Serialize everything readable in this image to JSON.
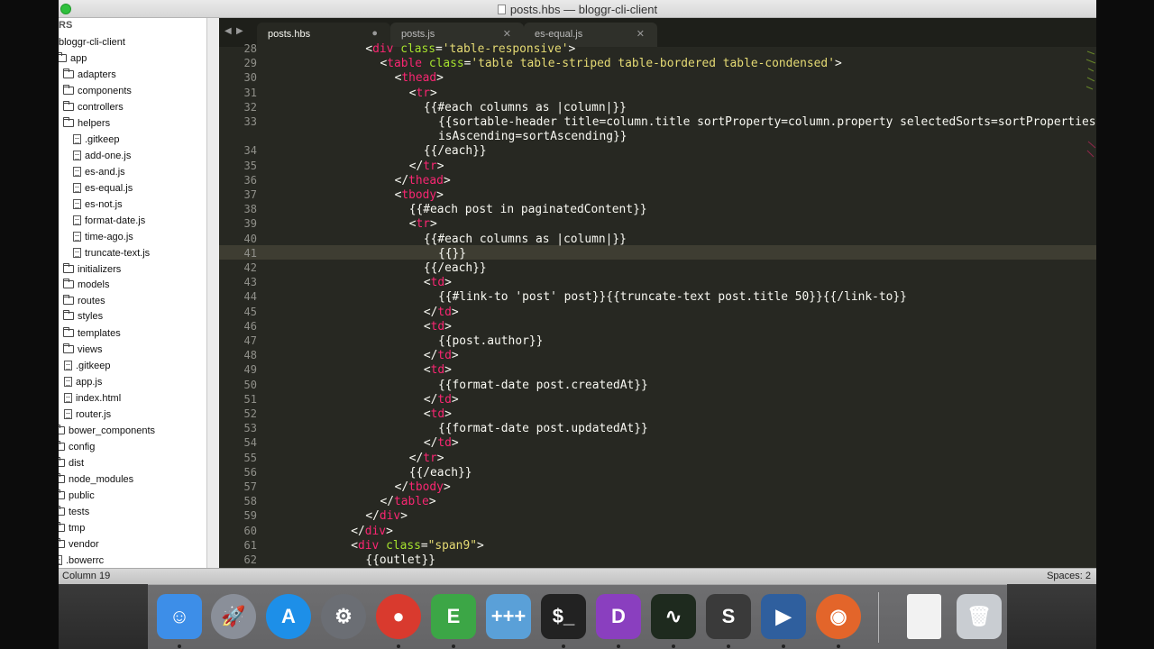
{
  "window": {
    "title": "posts.hbs — bloggr-cli-client"
  },
  "sidebar": {
    "header": "RS",
    "items": [
      {
        "label": "bloggr-cli-client",
        "kind": "root",
        "depth": 0
      },
      {
        "label": "app",
        "kind": "folder-open",
        "depth": 1
      },
      {
        "label": "adapters",
        "kind": "folder",
        "depth": 2
      },
      {
        "label": "components",
        "kind": "folder",
        "depth": 2
      },
      {
        "label": "controllers",
        "kind": "folder",
        "depth": 2
      },
      {
        "label": "helpers",
        "kind": "folder-open",
        "depth": 2
      },
      {
        "label": ".gitkeep",
        "kind": "file",
        "depth": 3
      },
      {
        "label": "add-one.js",
        "kind": "file",
        "depth": 3
      },
      {
        "label": "es-and.js",
        "kind": "file",
        "depth": 3
      },
      {
        "label": "es-equal.js",
        "kind": "file",
        "depth": 3
      },
      {
        "label": "es-not.js",
        "kind": "file",
        "depth": 3
      },
      {
        "label": "format-date.js",
        "kind": "file",
        "depth": 3
      },
      {
        "label": "time-ago.js",
        "kind": "file",
        "depth": 3
      },
      {
        "label": "truncate-text.js",
        "kind": "file",
        "depth": 3
      },
      {
        "label": "initializers",
        "kind": "folder",
        "depth": 2
      },
      {
        "label": "models",
        "kind": "folder",
        "depth": 2
      },
      {
        "label": "routes",
        "kind": "folder",
        "depth": 2
      },
      {
        "label": "styles",
        "kind": "folder",
        "depth": 2
      },
      {
        "label": "templates",
        "kind": "folder",
        "depth": 2
      },
      {
        "label": "views",
        "kind": "folder",
        "depth": 2
      },
      {
        "label": ".gitkeep",
        "kind": "file",
        "depth": 2
      },
      {
        "label": "app.js",
        "kind": "file",
        "depth": 2
      },
      {
        "label": "index.html",
        "kind": "file",
        "depth": 2
      },
      {
        "label": "router.js",
        "kind": "file",
        "depth": 2
      },
      {
        "label": "bower_components",
        "kind": "folder",
        "depth": 1
      },
      {
        "label": "config",
        "kind": "folder",
        "depth": 1
      },
      {
        "label": "dist",
        "kind": "folder",
        "depth": 1
      },
      {
        "label": "node_modules",
        "kind": "folder",
        "depth": 1
      },
      {
        "label": "public",
        "kind": "folder",
        "depth": 1
      },
      {
        "label": "tests",
        "kind": "folder",
        "depth": 1
      },
      {
        "label": "tmp",
        "kind": "folder",
        "depth": 1
      },
      {
        "label": "vendor",
        "kind": "folder",
        "depth": 1
      },
      {
        "label": ".bowerrc",
        "kind": "file",
        "depth": 1
      }
    ]
  },
  "tabs": [
    {
      "label": "posts.hbs",
      "active": true,
      "close": "●"
    },
    {
      "label": "posts.js",
      "active": false,
      "close": "✕"
    },
    {
      "label": "es-equal.js",
      "active": false,
      "close": "✕"
    }
  ],
  "tab_nav": {
    "prev": "◀",
    "next": "▶"
  },
  "editor": {
    "current_line": "41",
    "lines": [
      {
        "n": "28",
        "indent": 6,
        "segs": [
          [
            "<",
            "p"
          ],
          [
            "div",
            "tg"
          ],
          [
            " ",
            "p"
          ],
          [
            "class",
            "at"
          ],
          [
            "=",
            "p"
          ],
          [
            "'table-responsive'",
            "st"
          ],
          [
            ">",
            "p"
          ]
        ]
      },
      {
        "n": "29",
        "indent": 8,
        "segs": [
          [
            "<",
            "p"
          ],
          [
            "table",
            "tg"
          ],
          [
            " ",
            "p"
          ],
          [
            "class",
            "at"
          ],
          [
            "=",
            "p"
          ],
          [
            "'table table-striped table-bordered table-condensed'",
            "st"
          ],
          [
            ">",
            "p"
          ]
        ]
      },
      {
        "n": "30",
        "indent": 10,
        "segs": [
          [
            "<",
            "p"
          ],
          [
            "thead",
            "tg"
          ],
          [
            ">",
            "p"
          ]
        ]
      },
      {
        "n": "31",
        "indent": 12,
        "segs": [
          [
            "<",
            "p"
          ],
          [
            "tr",
            "tg"
          ],
          [
            ">",
            "p"
          ]
        ]
      },
      {
        "n": "32",
        "indent": 14,
        "segs": [
          [
            "{{#each columns as |column|}}",
            "p"
          ]
        ]
      },
      {
        "n": "33",
        "indent": 16,
        "segs": [
          [
            "{{sortable-header title=column.title sortProperty=column.property selectedSorts=sortProperties",
            "p"
          ]
        ]
      },
      {
        "n": "",
        "indent": 16,
        "segs": [
          [
            "isAscending=sortAscending}}",
            "p"
          ]
        ]
      },
      {
        "n": "34",
        "indent": 14,
        "segs": [
          [
            "{{/each}}",
            "p"
          ]
        ]
      },
      {
        "n": "35",
        "indent": 12,
        "segs": [
          [
            "</",
            "p"
          ],
          [
            "tr",
            "tg"
          ],
          [
            ">",
            "p"
          ]
        ]
      },
      {
        "n": "36",
        "indent": 10,
        "segs": [
          [
            "</",
            "p"
          ],
          [
            "thead",
            "tg"
          ],
          [
            ">",
            "p"
          ]
        ]
      },
      {
        "n": "37",
        "indent": 10,
        "segs": [
          [
            "<",
            "p"
          ],
          [
            "tbody",
            "tg"
          ],
          [
            ">",
            "p"
          ]
        ]
      },
      {
        "n": "38",
        "indent": 12,
        "segs": [
          [
            "{{#each post in paginatedContent}}",
            "p"
          ]
        ]
      },
      {
        "n": "39",
        "indent": 12,
        "segs": [
          [
            "<",
            "p"
          ],
          [
            "tr",
            "tg"
          ],
          [
            ">",
            "p"
          ]
        ]
      },
      {
        "n": "40",
        "indent": 14,
        "segs": [
          [
            "{{#each columns as |column|}}",
            "p"
          ]
        ]
      },
      {
        "n": "41",
        "indent": 16,
        "segs": [
          [
            "{{}}",
            "p"
          ]
        ]
      },
      {
        "n": "42",
        "indent": 14,
        "segs": [
          [
            "{{/each}}",
            "p"
          ]
        ]
      },
      {
        "n": "43",
        "indent": 14,
        "segs": [
          [
            "<",
            "p"
          ],
          [
            "td",
            "tg"
          ],
          [
            ">",
            "p"
          ]
        ]
      },
      {
        "n": "44",
        "indent": 16,
        "segs": [
          [
            "{{#link-to 'post' post}}{{truncate-text post.title 50}}{{/link-to}}",
            "p"
          ]
        ]
      },
      {
        "n": "45",
        "indent": 14,
        "segs": [
          [
            "</",
            "p"
          ],
          [
            "td",
            "tg"
          ],
          [
            ">",
            "p"
          ]
        ]
      },
      {
        "n": "46",
        "indent": 14,
        "segs": [
          [
            "<",
            "p"
          ],
          [
            "td",
            "tg"
          ],
          [
            ">",
            "p"
          ]
        ]
      },
      {
        "n": "47",
        "indent": 16,
        "segs": [
          [
            "{{post.author}}",
            "p"
          ]
        ]
      },
      {
        "n": "48",
        "indent": 14,
        "segs": [
          [
            "</",
            "p"
          ],
          [
            "td",
            "tg"
          ],
          [
            ">",
            "p"
          ]
        ]
      },
      {
        "n": "49",
        "indent": 14,
        "segs": [
          [
            "<",
            "p"
          ],
          [
            "td",
            "tg"
          ],
          [
            ">",
            "p"
          ]
        ]
      },
      {
        "n": "50",
        "indent": 16,
        "segs": [
          [
            "{{format-date post.createdAt}}",
            "p"
          ]
        ]
      },
      {
        "n": "51",
        "indent": 14,
        "segs": [
          [
            "</",
            "p"
          ],
          [
            "td",
            "tg"
          ],
          [
            ">",
            "p"
          ]
        ]
      },
      {
        "n": "52",
        "indent": 14,
        "segs": [
          [
            "<",
            "p"
          ],
          [
            "td",
            "tg"
          ],
          [
            ">",
            "p"
          ]
        ]
      },
      {
        "n": "53",
        "indent": 16,
        "segs": [
          [
            "{{format-date post.updatedAt}}",
            "p"
          ]
        ]
      },
      {
        "n": "54",
        "indent": 14,
        "segs": [
          [
            "</",
            "p"
          ],
          [
            "td",
            "tg"
          ],
          [
            ">",
            "p"
          ]
        ]
      },
      {
        "n": "55",
        "indent": 12,
        "segs": [
          [
            "</",
            "p"
          ],
          [
            "tr",
            "tg"
          ],
          [
            ">",
            "p"
          ]
        ]
      },
      {
        "n": "56",
        "indent": 12,
        "segs": [
          [
            "{{/each}}",
            "p"
          ]
        ]
      },
      {
        "n": "57",
        "indent": 10,
        "segs": [
          [
            "</",
            "p"
          ],
          [
            "tbody",
            "tg"
          ],
          [
            ">",
            "p"
          ]
        ]
      },
      {
        "n": "58",
        "indent": 8,
        "segs": [
          [
            "</",
            "p"
          ],
          [
            "table",
            "tg"
          ],
          [
            ">",
            "p"
          ]
        ]
      },
      {
        "n": "59",
        "indent": 6,
        "segs": [
          [
            "</",
            "p"
          ],
          [
            "div",
            "tg"
          ],
          [
            ">",
            "p"
          ]
        ]
      },
      {
        "n": "60",
        "indent": 4,
        "segs": [
          [
            "</",
            "p"
          ],
          [
            "div",
            "tg"
          ],
          [
            ">",
            "p"
          ]
        ]
      },
      {
        "n": "61",
        "indent": 4,
        "segs": [
          [
            "<",
            "p"
          ],
          [
            "div",
            "tg"
          ],
          [
            " ",
            "p"
          ],
          [
            "class",
            "at"
          ],
          [
            "=",
            "p"
          ],
          [
            "\"span9\"",
            "st"
          ],
          [
            ">",
            "p"
          ]
        ]
      },
      {
        "n": "62",
        "indent": 6,
        "segs": [
          [
            "{{outlet}}",
            "p"
          ]
        ]
      }
    ]
  },
  "statusbar": {
    "left": "Column 19",
    "right": "Spaces: 2"
  },
  "dock": {
    "apps": [
      {
        "name": "finder-icon",
        "glyph": "☺",
        "color": "#3d8ee8",
        "running": true
      },
      {
        "name": "launchpad-icon",
        "glyph": "🚀",
        "color": "#8a8f99",
        "running": false
      },
      {
        "name": "app-store-icon",
        "glyph": "A",
        "color": "#1d8fe8",
        "running": false
      },
      {
        "name": "system-preferences-icon",
        "glyph": "⚙",
        "color": "#6b6e74",
        "running": false
      },
      {
        "name": "chrome-icon",
        "glyph": "●",
        "color": "#d93a2e",
        "running": true
      },
      {
        "name": "evernote-icon",
        "glyph": "E",
        "color": "#3ca646",
        "running": true
      },
      {
        "name": "tables-icon",
        "glyph": "+++",
        "color": "#5aa0d8",
        "running": false
      },
      {
        "name": "terminal-icon",
        "glyph": "$_",
        "color": "#222222",
        "running": true
      },
      {
        "name": "dash-icon",
        "glyph": "D",
        "color": "#8a3fbf",
        "running": true
      },
      {
        "name": "activity-monitor-icon",
        "glyph": "∿",
        "color": "#1e2a1e",
        "running": true
      },
      {
        "name": "sublime-text-icon",
        "glyph": "S",
        "color": "#3a3a3a",
        "running": true
      },
      {
        "name": "screenflow-icon",
        "glyph": "▶",
        "color": "#2f5f9e",
        "running": true
      },
      {
        "name": "firefox-icon",
        "glyph": "◉",
        "color": "#e3652a",
        "running": true
      },
      {
        "name": "document-icon",
        "glyph": "",
        "color": "#f2f2f2",
        "running": false
      },
      {
        "name": "trash-icon",
        "glyph": "🗑",
        "color": "#c9cdd2",
        "running": false
      }
    ]
  }
}
